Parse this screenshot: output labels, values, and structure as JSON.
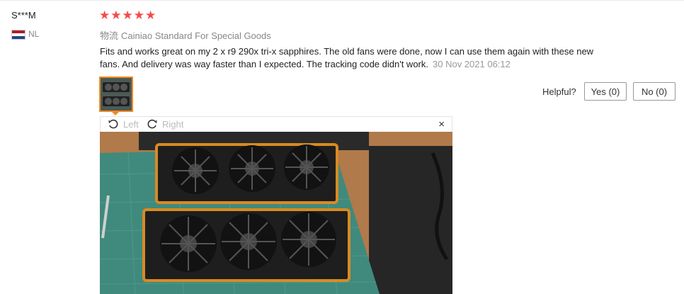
{
  "reviewer": {
    "name": "S***M",
    "country": "NL"
  },
  "colors": {
    "star": "#f44b4b",
    "accent": "#f5891d",
    "muted": "#999999"
  },
  "rating": {
    "stars": "★★★★★",
    "value": 5,
    "max": 5
  },
  "logistics": {
    "prefix": "物流",
    "method": "Cainiao Standard For Special Goods"
  },
  "review": {
    "text": "Fits and works great on my 2 x r9 290x tri-x sapphires. The old fans were done, now I can use them again with these new fans. And delivery was way faster than I expected. The tracking code didn't work.",
    "date": "30 Nov 2021 06:12"
  },
  "helpful": {
    "label": "Helpful?",
    "yes": "Yes (0)",
    "no": "No (0)"
  },
  "viewer": {
    "rotate_left": "Left",
    "rotate_right": "Right",
    "close": "×"
  },
  "icons": {
    "flag": "netherlands-flag-icon",
    "rotate_left": "rotate-left-icon",
    "rotate_right": "rotate-right-icon",
    "close": "close-icon"
  }
}
